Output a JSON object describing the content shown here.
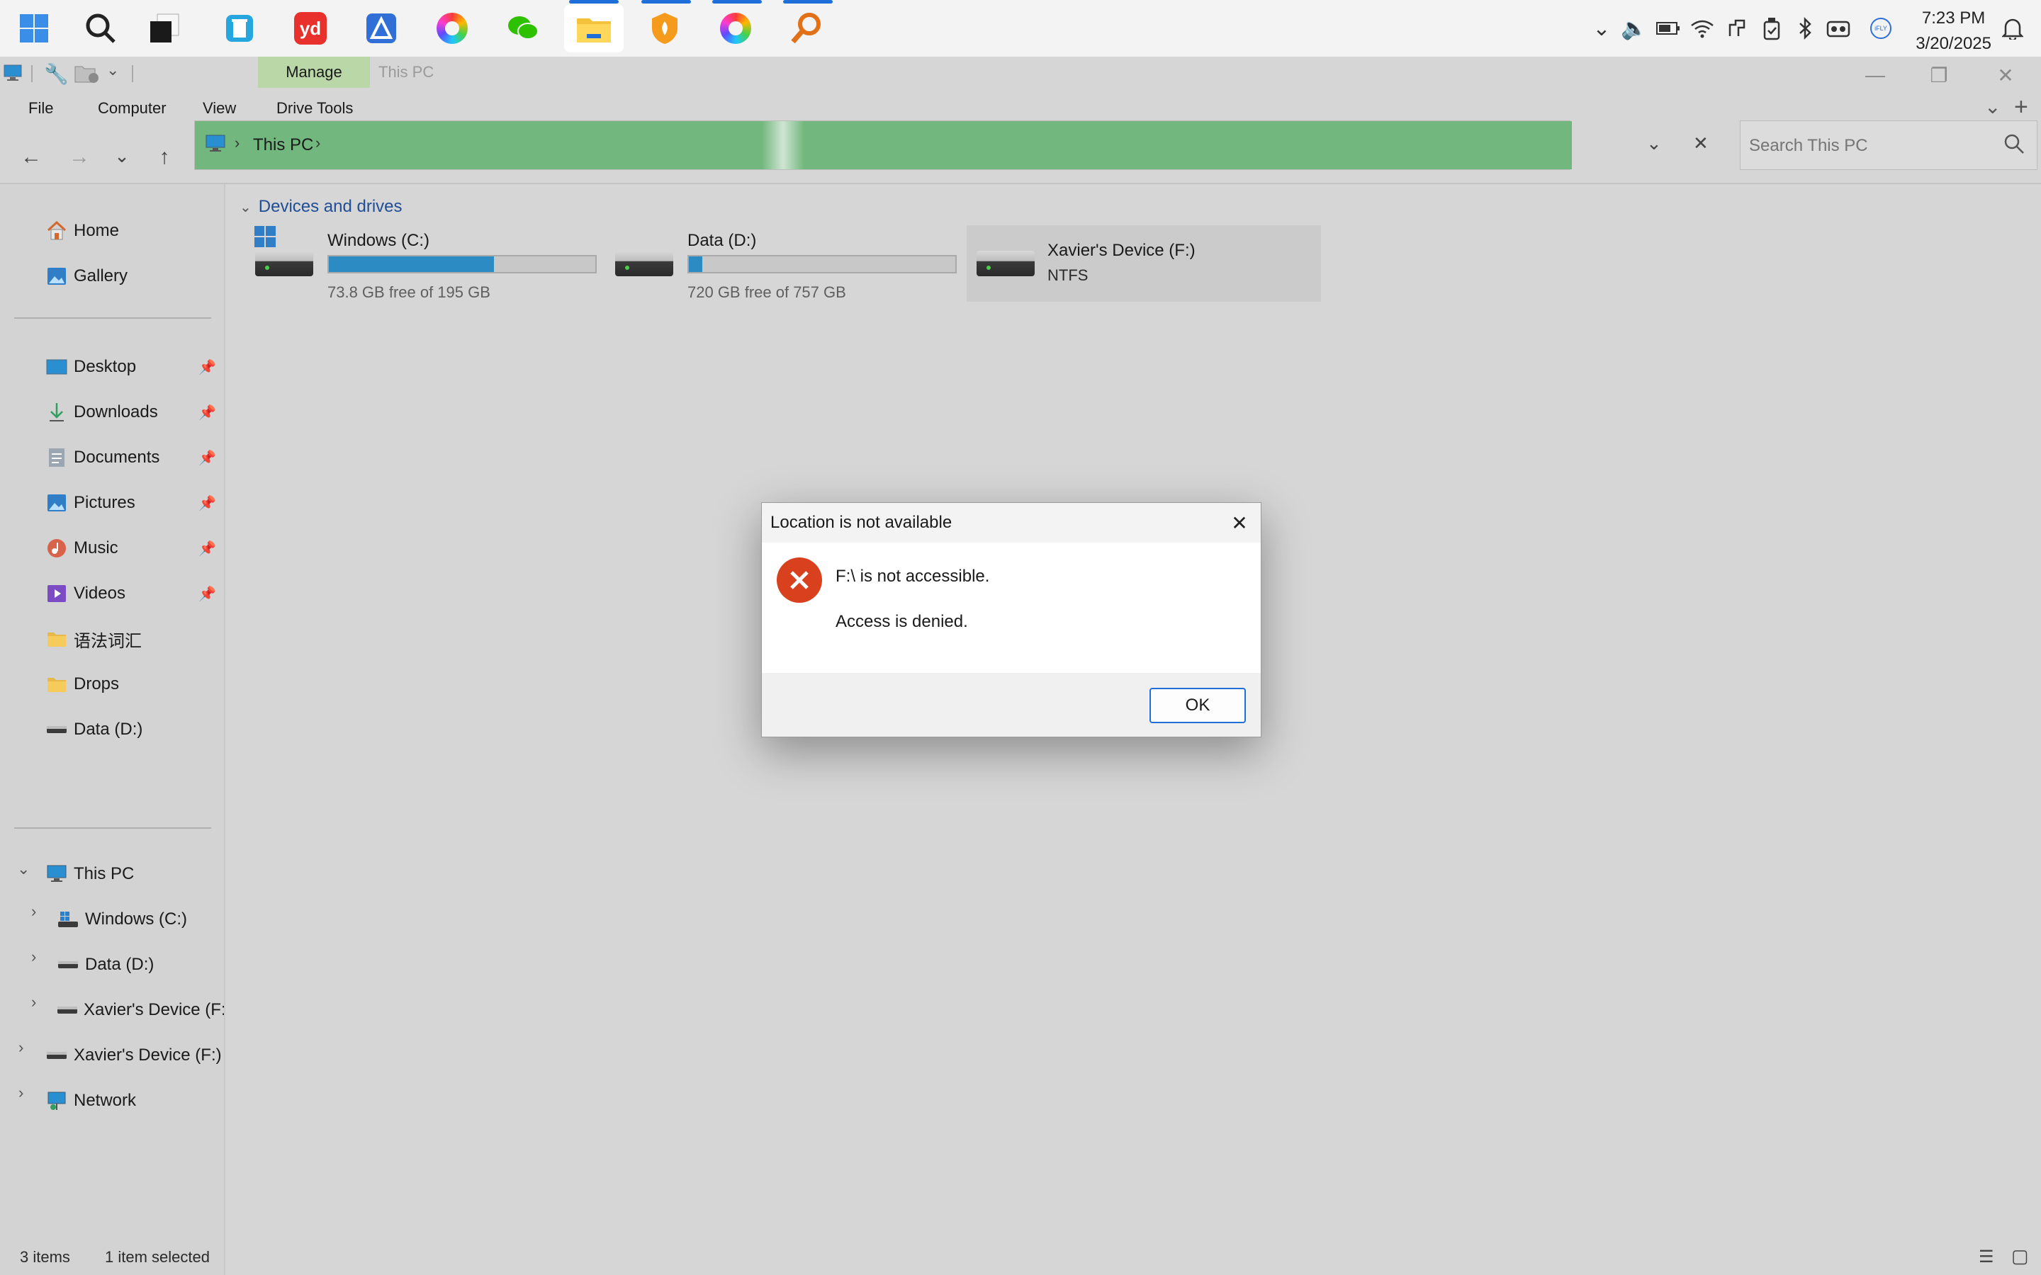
{
  "taskbar": {
    "apps": [
      {
        "name": "start",
        "icon": "windows-logo-icon"
      },
      {
        "name": "search",
        "icon": "search-icon"
      },
      {
        "name": "task-view",
        "icon": "task-view-icon"
      },
      {
        "name": "recycle-app",
        "icon": "recycle-bin-icon"
      },
      {
        "name": "youdao",
        "icon": "youdao-icon",
        "glyph": "yd"
      },
      {
        "name": "app-blue",
        "icon": "blue-app-icon"
      },
      {
        "name": "browser-1",
        "icon": "color-wheel-icon"
      },
      {
        "name": "wechat",
        "icon": "wechat-icon"
      },
      {
        "name": "file-explorer",
        "icon": "folder-icon"
      },
      {
        "name": "security",
        "icon": "shield-icon"
      },
      {
        "name": "browser-2",
        "icon": "color-wheel-icon"
      },
      {
        "name": "everything-search",
        "icon": "magnifier-icon"
      }
    ],
    "time": "7:23 PM",
    "date": "3/20/2025"
  },
  "titlebar": {
    "context_tab": "Manage",
    "window_title": "This PC"
  },
  "ribbon": {
    "tabs": [
      "File",
      "Computer",
      "View",
      "Drive Tools"
    ]
  },
  "address": {
    "location": "This PC",
    "search_placeholder": "Search This PC"
  },
  "sidebar": {
    "top": [
      {
        "label": "Home",
        "icon": "home-icon"
      },
      {
        "label": "Gallery",
        "icon": "gallery-icon"
      }
    ],
    "pinned": [
      {
        "label": "Desktop",
        "icon": "desktop-icon"
      },
      {
        "label": "Downloads",
        "icon": "download-icon"
      },
      {
        "label": "Documents",
        "icon": "document-icon"
      },
      {
        "label": "Pictures",
        "icon": "pictures-icon"
      },
      {
        "label": "Music",
        "icon": "music-icon"
      },
      {
        "label": "Videos",
        "icon": "video-icon"
      },
      {
        "label": "语法词汇",
        "icon": "folder-icon"
      },
      {
        "label": "Drops",
        "icon": "folder-icon"
      },
      {
        "label": "Data (D:)",
        "icon": "drive-icon"
      }
    ],
    "tree": [
      {
        "label": "This PC",
        "icon": "computer-icon"
      },
      {
        "label": "Windows (C:)",
        "icon": "windows-drive-icon"
      },
      {
        "label": "Data (D:)",
        "icon": "drive-icon"
      },
      {
        "label": "Xavier's Device (F:",
        "icon": "drive-icon"
      },
      {
        "label": "Xavier's Device (F:)",
        "icon": "drive-icon"
      },
      {
        "label": "Network",
        "icon": "network-icon"
      }
    ]
  },
  "content": {
    "group_title": "Devices and drives",
    "drives": [
      {
        "name": "Windows (C:)",
        "sub": "73.8 GB free of 195 GB",
        "used_fraction": 0.62
      },
      {
        "name": "Data (D:)",
        "sub": "720 GB free of 757 GB",
        "used_fraction": 0.05
      },
      {
        "name": "Xavier's Device (F:)",
        "sub": "NTFS"
      }
    ]
  },
  "status": {
    "items": "3 items",
    "selected": "1 item selected"
  },
  "dialog": {
    "title": "Location is not available",
    "message": "F:\\ is not accessible.",
    "detail": "Access is denied.",
    "ok_label": "OK"
  },
  "colors": {
    "accent": "#1e6fd9",
    "address_fill": "#72b77d",
    "manage_tab": "#b9d7a7",
    "error_red": "#d9411e",
    "drive_bar": "#2d8bc4"
  }
}
